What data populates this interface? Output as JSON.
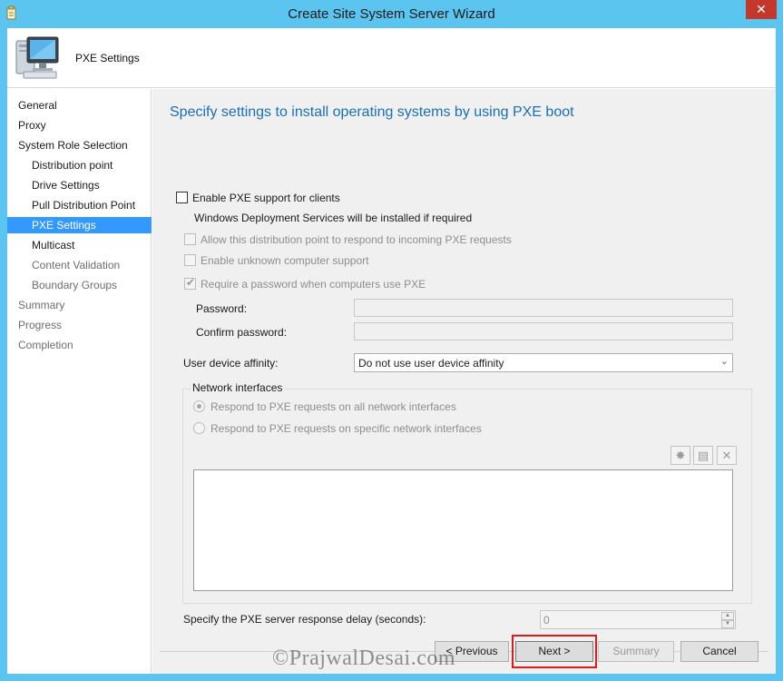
{
  "window": {
    "title": "Create Site System Server Wizard",
    "close_glyph": "✕"
  },
  "header": {
    "page_label": "PXE Settings",
    "icon": "computer-icon"
  },
  "nav": {
    "items": [
      {
        "label": "General",
        "state": "normal"
      },
      {
        "label": "Proxy",
        "state": "normal"
      },
      {
        "label": "System Role Selection",
        "state": "normal"
      },
      {
        "label": "Distribution point",
        "state": "normal"
      },
      {
        "label": "Drive Settings",
        "state": "normal"
      },
      {
        "label": "Pull Distribution Point",
        "state": "normal"
      },
      {
        "label": "PXE Settings",
        "state": "selected"
      },
      {
        "label": "Multicast",
        "state": "normal"
      },
      {
        "label": "Content Validation",
        "state": "disabled"
      },
      {
        "label": "Boundary Groups",
        "state": "disabled"
      },
      {
        "label": "Summary",
        "state": "disabled"
      },
      {
        "label": "Progress",
        "state": "disabled"
      },
      {
        "label": "Completion",
        "state": "disabled"
      }
    ]
  },
  "main": {
    "heading": "Specify settings to install operating systems by using PXE boot",
    "enable_pxe": {
      "label": "Enable PXE support for clients",
      "checked": false
    },
    "wds_note": "Windows Deployment Services will be installed if required",
    "allow_respond": {
      "label": "Allow this distribution point to respond to incoming PXE requests",
      "checked": false
    },
    "unknown_support": {
      "label": "Enable unknown computer support",
      "checked": false
    },
    "require_password": {
      "label": "Require a password when computers use PXE",
      "checked": true
    },
    "password_label": "Password:",
    "password_value": "",
    "confirm_label": "Confirm password:",
    "confirm_value": "",
    "affinity_label": "User device affinity:",
    "affinity_value": "Do not use user device affinity",
    "network": {
      "title": "Network interfaces",
      "option_all": {
        "label": "Respond to PXE requests on all network interfaces",
        "selected": true
      },
      "option_specific": {
        "label": "Respond to PXE requests on specific network interfaces",
        "selected": false
      },
      "toolbar": {
        "new_glyph": "✸",
        "properties_glyph": "▤",
        "delete_glyph": "✕"
      }
    },
    "delay_label": "Specify the PXE server response delay (seconds):",
    "delay_value": "0"
  },
  "buttons": {
    "previous": "< Previous",
    "next": "Next >",
    "summary": "Summary",
    "cancel": "Cancel"
  },
  "watermark": "©PrajwalDesai.com",
  "colors": {
    "title_bar": "#5bc4ef",
    "selection": "#3399ff",
    "heading": "#1b6fb5",
    "highlight_box": "#e01a1a"
  }
}
